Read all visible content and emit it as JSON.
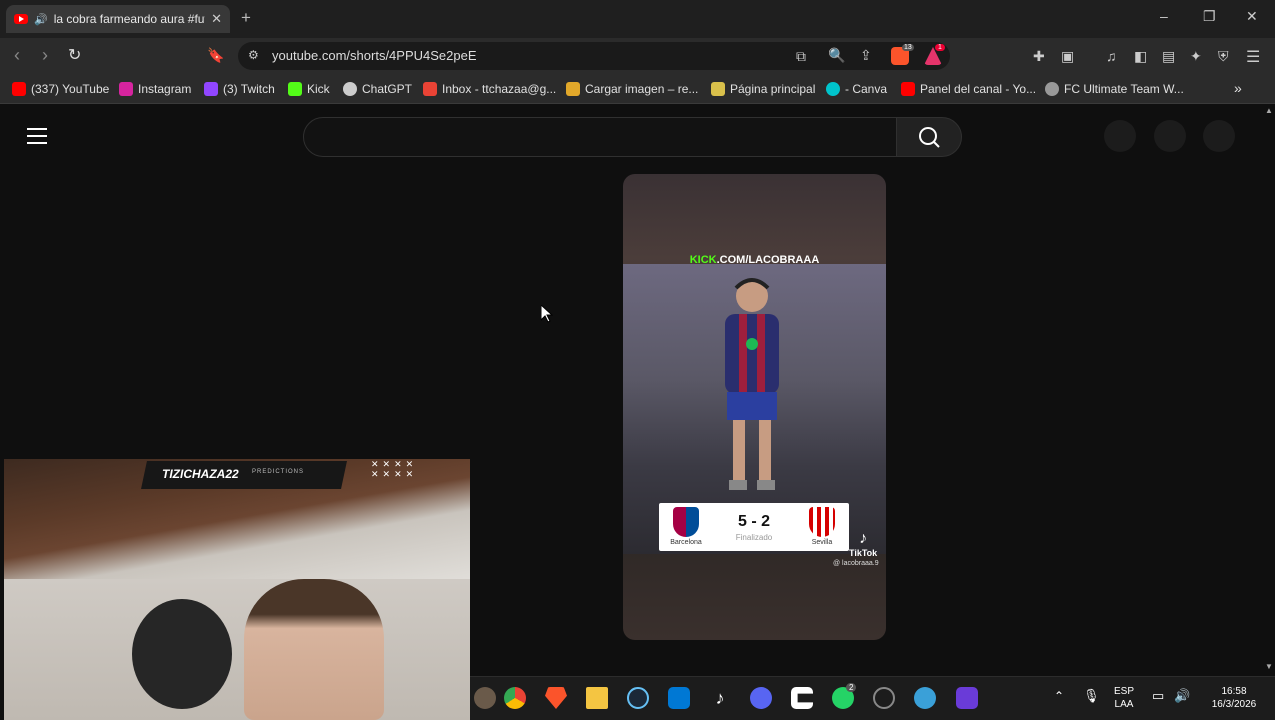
{
  "browser": {
    "tab_title": "la cobra farmeando aura #futbol",
    "new_tab": "+",
    "window_controls": [
      "–",
      "❐",
      "✕"
    ],
    "url": "youtube.com/shorts/4PPU4Se2peE",
    "brave_shield_count": "13",
    "alert_count": "1"
  },
  "bookmarks": [
    {
      "label": "(337) YouTube",
      "color": "#ff0000"
    },
    {
      "label": "Instagram",
      "color": "#d6249f"
    },
    {
      "label": "(3) Twitch",
      "color": "#9146ff"
    },
    {
      "label": "Kick",
      "color": "#53fc18"
    },
    {
      "label": "ChatGPT",
      "color": "#cccccc"
    },
    {
      "label": "Inbox - ttchazaa@g...",
      "color": "#ea4335"
    },
    {
      "label": "Cargar imagen – re...",
      "color": "#e2a82a"
    },
    {
      "label": "Página principal",
      "color": "#d9c04b"
    },
    {
      "label": "- Canva",
      "color": "#00c4cc"
    },
    {
      "label": "Panel del canal - Yo...",
      "color": "#ff0000"
    },
    {
      "label": "FC Ultimate Team W...",
      "color": "#999999"
    }
  ],
  "short": {
    "kick_label_prefix": "KICK",
    "kick_label_suffix": ".COM/LACOBRAAA",
    "score": "5 - 2",
    "status": "Finalizado",
    "home_team": "Barcelona",
    "away_team": "Sevilla",
    "tiktok": "TikTok",
    "handle": "@ lacobraaa.9"
  },
  "webcam": {
    "name": "TIZICHAZA22",
    "predictions": "PREDICTIONS"
  },
  "taskbar": {
    "lang": "ESP",
    "lang2": "LAA",
    "time": "16:58",
    "date": "16/3/2026",
    "discord_badge": "2"
  }
}
